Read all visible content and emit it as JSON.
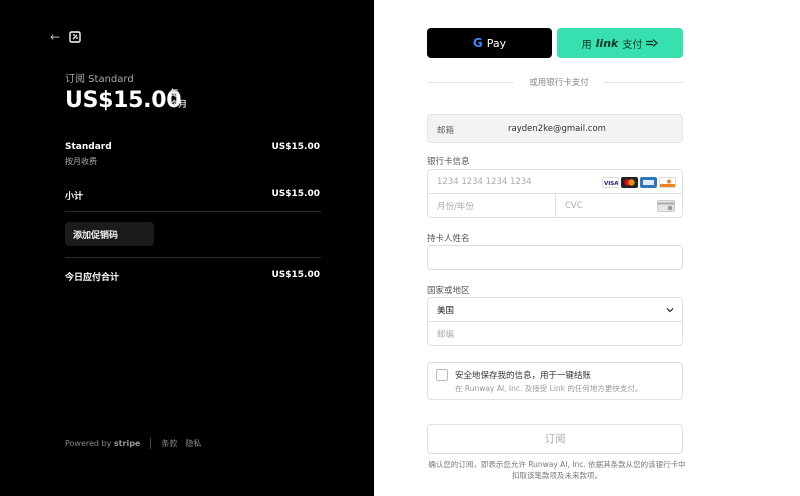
{
  "summary": {
    "plan_heading": "订阅 Standard",
    "price": "US$15.00",
    "per_line1": "每",
    "per_line2": "个月",
    "line_item": {
      "name": "Standard",
      "sub": "按月收费",
      "amount": "US$15.00"
    },
    "subtotal": {
      "label": "小计",
      "amount": "US$15.00"
    },
    "promo_label": "添加促销码",
    "total": {
      "label": "今日应付合计",
      "amount": "US$15.00"
    }
  },
  "footer": {
    "powered_prefix": "Powered by ",
    "powered_brand": "stripe",
    "terms": "条款",
    "privacy": "隐私"
  },
  "payment": {
    "gpay_g": "G",
    "gpay_label": "Pay",
    "link_prefix": "用",
    "link_brand": "link",
    "link_suffix": "支付",
    "or_text": "或用银行卡支付"
  },
  "form": {
    "email_label": "邮箱",
    "email_value": "rayden2ke@gmail.com",
    "card_label": "银行卡信息",
    "card_number_placeholder": "1234 1234 1234 1234",
    "expiry_placeholder": "月份/年份",
    "cvc_placeholder": "CVC",
    "card_brands": [
      "VISA",
      "Mastercard",
      "American Express",
      "DISCOVER"
    ],
    "cardholder_label": "持卡人姓名",
    "cardholder_placeholder": "",
    "country_label": "国家或地区",
    "country_value": "美国",
    "zip_placeholder": "邮编",
    "save_info_title": "安全地保存我的信息，用于一键结账",
    "save_info_sub": "在 Runway AI, Inc. 及接受 Link 的任何地方更快支付。",
    "subscribe_label": "订阅",
    "terms_text": "确认您的订阅，即表示您允许 Runway AI, Inc. 依据其条款从您的该银行卡中扣取该笔款项及未来款项。"
  },
  "colors": {
    "left_bg": "#000000",
    "link_green": "#38e0b0"
  }
}
